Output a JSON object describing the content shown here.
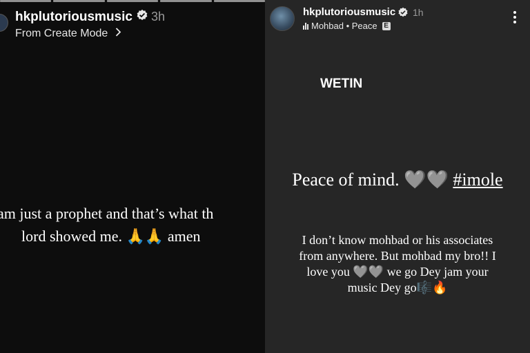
{
  "left_story": {
    "username": "hkplutoriousmusic",
    "time": "3h",
    "subtitle": "From Create Mode",
    "caption_line1": "am just a prophet and that’s what th",
    "caption_line2": "lord showed me. 🙏🙏 amen"
  },
  "right_story": {
    "username": "hkplutoriousmusic",
    "time": "1h",
    "music": "Mohbad • Peace",
    "explicit_badge": "E",
    "heading": "WETIN",
    "peace_text": "Peace of mind. 🩶🩶 ",
    "hashtag": "#imole",
    "message_lines": [
      "I don’t know mohbad or his associates",
      "from anywhere. But mohbad my bro!! I",
      "love you 🩶🩶 we go Dey jam your",
      "music Dey go🎼🔥"
    ]
  },
  "icons": {
    "verified": "verified-badge-icon",
    "chevron": "chevron-right-icon",
    "more": "more-vertical-icon",
    "music": "music-bars-icon"
  }
}
